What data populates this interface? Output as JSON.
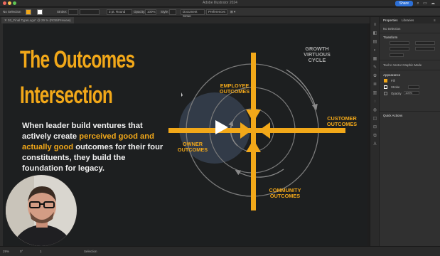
{
  "app": {
    "title": "Adobe Illustrator 2024",
    "share_label": "Share"
  },
  "controlbar": {
    "selection": "No Selection",
    "stroke_label": "Stroke:",
    "stroke_profile": "3 pt. Round",
    "opacity_label": "Opacity:",
    "opacity_value": "100%",
    "style_label": "Style:",
    "document_setup": "Document Setup",
    "preferences": "Preferences"
  },
  "document": {
    "tab_label": "03_Final TypeLogo* @ 29 % (RGB/Preview)"
  },
  "slide": {
    "title_line1": "The Outcomes",
    "title_line2": "Intersection",
    "body_part1": "When leader build ventures that actively create ",
    "body_highlight": "perceived good and actually good",
    "body_part2": " outcomes for their four constituents, they build the foundation for legacy."
  },
  "diagram": {
    "employee": [
      "EMPLOYEE",
      "OUTCOMES"
    ],
    "customer": [
      "CUSTOMER",
      "OUTCOMES"
    ],
    "owner": [
      "OWNER",
      "OUTCOMES"
    ],
    "community": [
      "COMMUNITY",
      "OUTCOMES"
    ],
    "cycle": [
      "GROWTH",
      "VIRTUOUS",
      "CYCLE"
    ],
    "accent_color": "#f2a819",
    "grey_color": "#a9a9a9"
  },
  "panel": {
    "tab_properties": "Properties",
    "tab_libraries": "Libraries",
    "no_selection": "No Selection",
    "transform_label": "Transform",
    "tool_label": "Tool to Vector Graphic Mode",
    "appearance_label": "Appearance",
    "fill_label": "Fill",
    "stroke_label": "Stroke",
    "opacity_label": "Opacity",
    "opacity_value": "100%",
    "quick_actions_label": "Quick Actions"
  },
  "statusbar": {
    "zoom": "29%",
    "angle": "0°",
    "artboard": "1",
    "tool": "Selection"
  }
}
